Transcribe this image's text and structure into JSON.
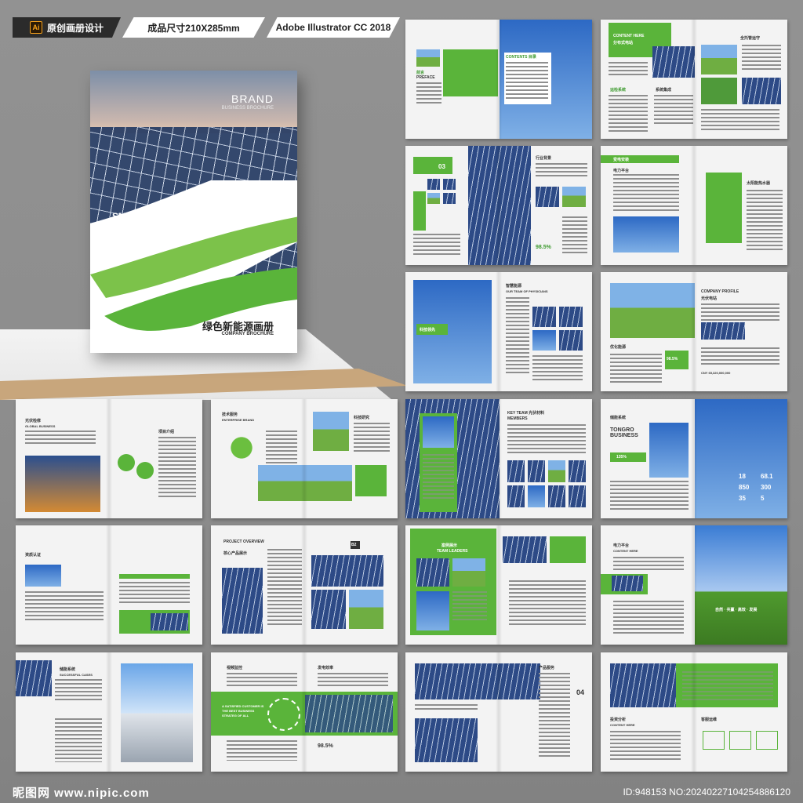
{
  "header": {
    "ai_badge": "Ai",
    "label1": "原创画册设计",
    "label2": "成品尺寸210X285mm",
    "label3": "Adobe Illustrator CC 2018"
  },
  "cover": {
    "brand": "BRAND",
    "brand_sub": "BUSINESS BROCHURE",
    "smart": "SMART BUSINESS BROCHURE",
    "title_cn": "绿色新能源画册",
    "title_en": "COMPANY BROCHURE"
  },
  "spreads": {
    "s1": {
      "preface": "前言",
      "preface_en": "PREFACE",
      "contents": "CONTENTS 目录"
    },
    "s2": {
      "content_here": "CONTENT HERE",
      "sub": "分布式电站",
      "title1": "全托管运守",
      "sys1": "运检系统",
      "sys2": "系统集成"
    },
    "s3": {
      "num": "03",
      "title": "行业背景",
      "pct": "98.5%"
    },
    "s4": {
      "title": "变电安装",
      "t1": "电力平台",
      "t2": "太阳能热水器"
    },
    "s5": {
      "title": "智慧能源",
      "sub": "OUR TEAM OF PHYSICIANS",
      "tag": "科技领先"
    },
    "s6": {
      "title": "COMPANY PROFILE",
      "sub": "光伏电站",
      "t2": "优化能源",
      "pct": "98.5%",
      "cny": "CNY 65,320,000,000"
    },
    "s7": {
      "title": "光伏检修",
      "sub": "GLOBAL BUSINESS",
      "item": "项目介绍"
    },
    "s8": {
      "title": "技术服务",
      "sub": "ENTERPRISE BRAND",
      "t2": "科技研究"
    },
    "s9": {
      "title": "KEY TEAM 光伏材料",
      "sub": "MEMBERS"
    },
    "s10": {
      "title": "储能系统",
      "big": "TONGRO BUSINESS",
      "pct": "135%",
      "n1": "18",
      "n2": "68.1",
      "n3": "850",
      "n4": "300",
      "n5": "35",
      "n6": "5"
    },
    "s11": {
      "title": "资质认证"
    },
    "s12": {
      "title": "PROJECT OVERVIEW",
      "sub": "核心产品展示",
      "code": "B2"
    },
    "s13": {
      "title": "案例展示",
      "sub": "TEAM LEADERS"
    },
    "s14": {
      "title": "电力平台",
      "sub": "CONTENT HERE",
      "caption": "自然 · 共赢 · 高效 · 发展"
    },
    "s15": {
      "title": "储能系统",
      "sub": "SUCCESSFUL CASES"
    },
    "s16": {
      "title": "视频监控",
      "t2": "发电效率",
      "slogan": "A SATISFIED CUSTOMER IS THE BEST BUSINESS STRATEG OF ALL",
      "pct": "98.5%"
    },
    "s17": {
      "num": "04",
      "t1": "产品服务"
    },
    "s18": {
      "t1": "投资分析",
      "t2": "客服运维",
      "sub": "CONTENT HERE"
    }
  },
  "watermark": {
    "left": "昵图网 www.nipic.com",
    "right": "ID:948153 NO:20240227104254886120"
  },
  "colors": {
    "accent": "#5ab43a",
    "accent_dark": "#3c9a2e",
    "panel_blue": "#2d4a86"
  }
}
